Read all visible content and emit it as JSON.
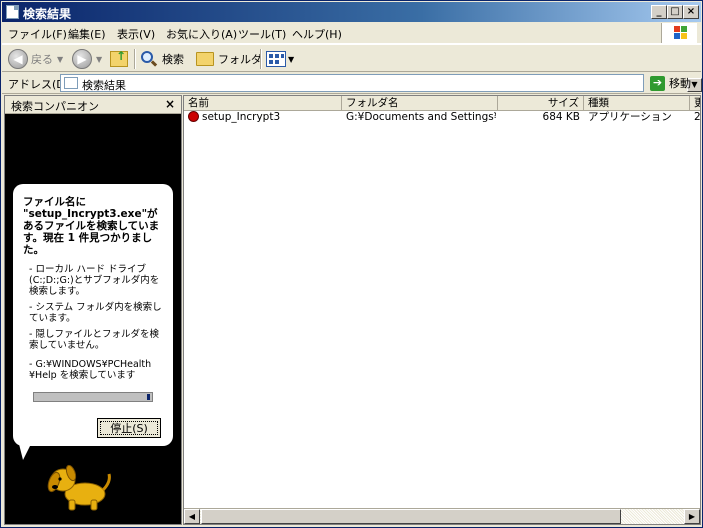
{
  "window": {
    "title": "検索結果"
  },
  "menu": [
    "ファイル(F)",
    "編集(E)",
    "表示(V)",
    "お気に入り(A)",
    "ツール(T)",
    "ヘルプ(H)"
  ],
  "toolbar": {
    "back_label": "戻る",
    "search_label": "検索",
    "folders_label": "フォルダ"
  },
  "address": {
    "label": "アドレス(D)",
    "value": "検索結果",
    "go_label": "移動"
  },
  "companion": {
    "title": "検索コンパニオン",
    "headline": "ファイル名に \"setup_Incrypt3.exe\"があるファイルを検索しています。現在 1 件見つかりました。",
    "bullets": [
      "- ローカル ハード ドライブ (C:;D:;G:)とサブフォルダ内を検索します。",
      "- システム フォルダ内を検索しています。",
      "- 隠しファイルとフォルダを検索していません。",
      "- G:¥WINDOWS¥PCHealth¥Help を検索しています"
    ],
    "stop_label": "停止(S)"
  },
  "list": {
    "columns": [
      "名前",
      "フォルダ名",
      "サイズ",
      "種類",
      "更"
    ],
    "rows": [
      {
        "name": "setup_Incrypt3",
        "folder": "G:¥Documents and Settings¥ta...",
        "size": "684 KB",
        "type": "アプリケーション",
        "modified": "2"
      }
    ]
  },
  "colors": {
    "title_bar": "#0a246a",
    "window_bg": "#ece9d8",
    "companion_bg": "#000000",
    "dog": "#e8b010"
  }
}
